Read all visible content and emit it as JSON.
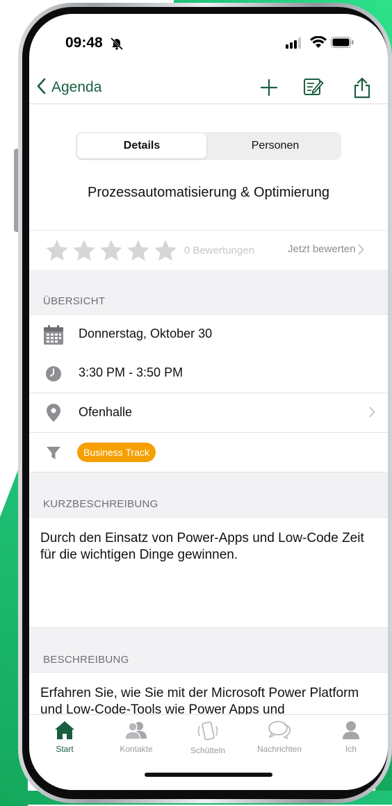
{
  "status_bar": {
    "time": "09:48"
  },
  "nav": {
    "back_label": "Agenda"
  },
  "segmented": {
    "details": "Details",
    "persons": "Personen"
  },
  "session": {
    "title": "Prozessautomatisierung & Optimierung"
  },
  "rating": {
    "stars_filled": 0,
    "stars_total": 5,
    "count_label": "0 Bewertungen",
    "rate_now": "Jetzt bewerten"
  },
  "overview": {
    "header": "ÜBERSICHT",
    "date": "Donnerstag, Oktober 30",
    "time": "3:30 PM - 3:50 PM",
    "location": "Ofenhalle",
    "track": "Business Track"
  },
  "short_desc": {
    "header": "KURZBESCHREIBUNG",
    "text": "Durch den Einsatz von Power-Apps und Low-Code Zeit für die wichtigen Dinge gewinnen."
  },
  "description": {
    "header": "BESCHREIBUNG",
    "text": "Erfahren Sie, wie Sie mit der Microsoft Power Platform und Low-Code-Tools wie Power Apps und"
  },
  "tabs": [
    {
      "label": "Start",
      "icon": "home-icon",
      "active": true
    },
    {
      "label": "Kontakte",
      "icon": "contacts-icon",
      "active": false
    },
    {
      "label": "Schütteln",
      "icon": "shake-phone-icon",
      "active": false
    },
    {
      "label": "Nachrichten",
      "icon": "chat-icon",
      "active": false
    },
    {
      "label": "Ich",
      "icon": "person-icon",
      "active": false
    }
  ],
  "colors": {
    "accent": "#1b5e3f",
    "badge": "#f5a000",
    "section_bg": "#f2f2f4"
  }
}
